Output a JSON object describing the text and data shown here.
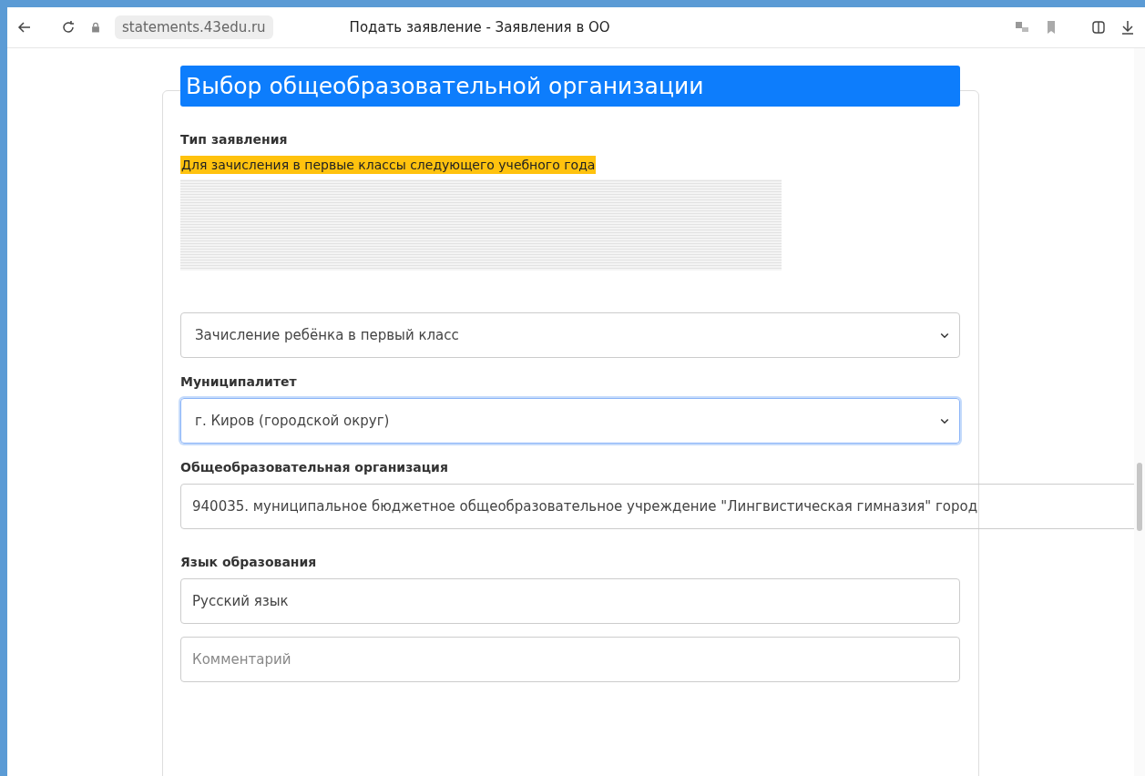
{
  "browser": {
    "url": "statements.43edu.ru",
    "title": "Подать заявление - Заявления в ОО"
  },
  "form": {
    "heading": "Выбор общеобразовательной организации",
    "type_label": "Тип заявления",
    "type_value": "Для зачисления в первые классы следующего учебного года",
    "kind_select": {
      "value": "Зачисление ребёнка в первый класс",
      "focused": false
    },
    "municipality_label": "Муниципалитет",
    "municipality_select": {
      "value": "г. Киров (городской округ)",
      "focused": true
    },
    "org_label": "Общеобразовательная организация",
    "org_value": "940035. муниципальное бюджетное общеобразовательное учреждение \"Лингвистическая гимназия\" город",
    "language_label": "Язык образования",
    "language_value": "Русский язык",
    "comment_placeholder": "Комментарий"
  }
}
